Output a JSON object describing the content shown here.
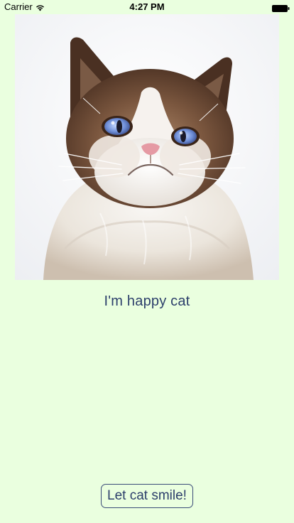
{
  "status_bar": {
    "carrier": "Carrier",
    "time": "4:27 PM",
    "wifi_icon": "wifi-icon",
    "battery_icon": "battery-icon"
  },
  "main": {
    "image_subject": "grumpy-cat-photo",
    "caption": "I'm happy cat",
    "button_label": "Let cat smile!"
  },
  "colors": {
    "background": "#eaffdf",
    "text_accent": "#2c3f6b",
    "button_border": "#3a4b78"
  }
}
